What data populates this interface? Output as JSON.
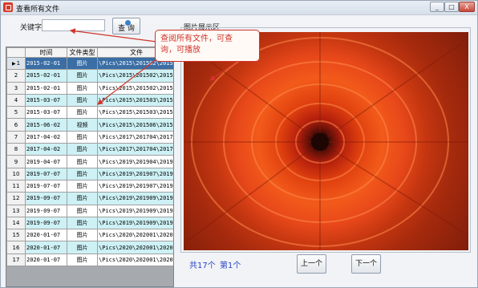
{
  "window": {
    "title": "查看所有文件",
    "min": "_",
    "max": "□",
    "close": "X"
  },
  "search": {
    "label": "关键字:",
    "value": "",
    "button": "查 询"
  },
  "callout": {
    "line1": "查阅所有文件，可查",
    "line2": "询，可播放"
  },
  "grid": {
    "headers": [
      "时间",
      "文件类型",
      "文件"
    ],
    "rows": [
      {
        "n": "1",
        "time": "2015-02-01",
        "type": "图片",
        "file": "\\Pics\\2015\\201502\\2015"
      },
      {
        "n": "2",
        "time": "2015-02-01",
        "type": "图片",
        "file": "\\Pics\\2015\\201502\\2015"
      },
      {
        "n": "3",
        "time": "2015-02-01",
        "type": "图片",
        "file": "\\Pics\\2015\\201502\\2015"
      },
      {
        "n": "4",
        "time": "2015-03-07",
        "type": "图片",
        "file": "\\Pics\\2015\\201503\\2015"
      },
      {
        "n": "5",
        "time": "2015-03-07",
        "type": "图片",
        "file": "\\Pics\\2015\\201503\\2015"
      },
      {
        "n": "6",
        "time": "2015-06-02",
        "type": "视频",
        "file": "\\Pics\\2015\\201506\\2015"
      },
      {
        "n": "7",
        "time": "2017-04-02",
        "type": "图片",
        "file": "\\Pics\\2017\\201704\\2017"
      },
      {
        "n": "8",
        "time": "2017-04-02",
        "type": "图片",
        "file": "\\Pics\\2017\\201704\\2017"
      },
      {
        "n": "9",
        "time": "2019-04-07",
        "type": "图片",
        "file": "\\Pics\\2019\\201904\\2019"
      },
      {
        "n": "10",
        "time": "2019-07-07",
        "type": "图片",
        "file": "\\Pics\\2019\\201907\\2019"
      },
      {
        "n": "11",
        "time": "2019-07-07",
        "type": "图片",
        "file": "\\Pics\\2019\\201907\\2019"
      },
      {
        "n": "12",
        "time": "2019-09-07",
        "type": "图片",
        "file": "\\Pics\\2019\\201909\\2019"
      },
      {
        "n": "13",
        "time": "2019-09-07",
        "type": "图片",
        "file": "\\Pics\\2019\\201909\\2019"
      },
      {
        "n": "14",
        "time": "2019-09-07",
        "type": "图片",
        "file": "\\Pics\\2019\\201909\\2019"
      },
      {
        "n": "15",
        "time": "2020-01-07",
        "type": "图片",
        "file": "\\Pics\\2020\\202001\\2020"
      },
      {
        "n": "16",
        "time": "2020-01-07",
        "type": "图片",
        "file": "\\Pics\\2020\\202001\\2020"
      },
      {
        "n": "17",
        "time": "2020-01-07",
        "type": "图片",
        "file": "\\Pics\\2020\\202001\\2020"
      }
    ]
  },
  "image_area": {
    "label": "图片展示区"
  },
  "pager": {
    "count": "共17个",
    "current": "第1个",
    "prev": "上一个",
    "next": "下一个"
  },
  "colors": {
    "accent": "#d0342c",
    "selected_row": "#3a6ea5",
    "alt_row": "#cdf1f5",
    "link": "#2b45c5"
  },
  "icons": {
    "app": "app-icon",
    "search": "search-icon",
    "row_pointer": "row-pointer-icon"
  }
}
